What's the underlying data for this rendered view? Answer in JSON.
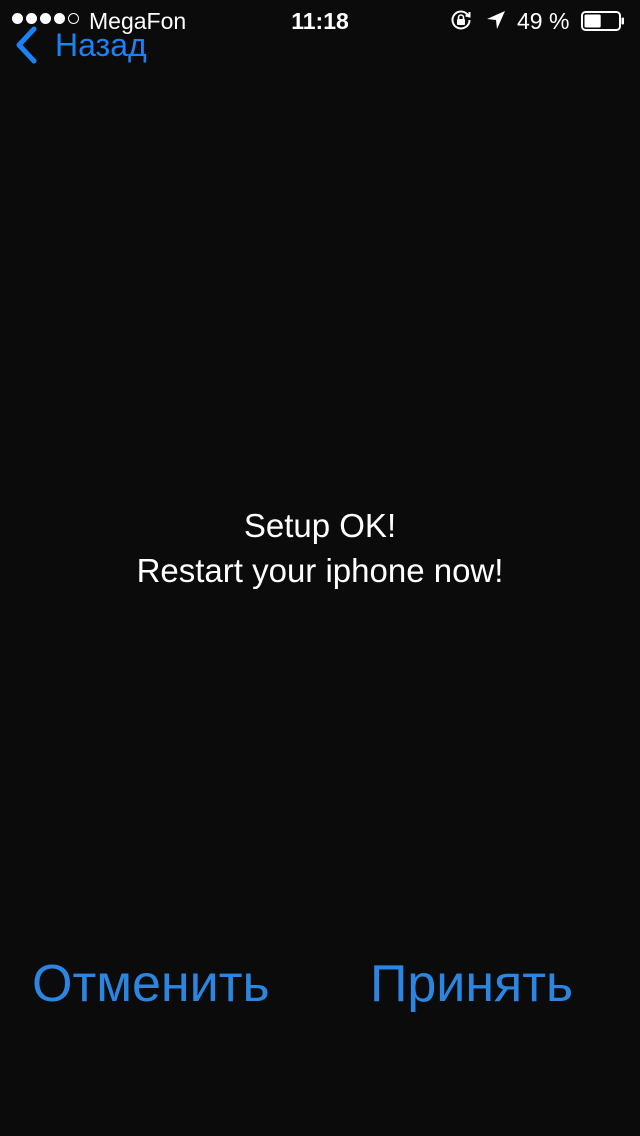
{
  "status_bar": {
    "signal_dots": [
      true,
      true,
      true,
      true,
      false
    ],
    "carrier": "MegaFon",
    "time": "11:18",
    "battery_percent_text": "49 %",
    "battery_level": 0.49,
    "icons": [
      "rotation-lock-icon",
      "location-arrow-icon",
      "battery-icon"
    ]
  },
  "nav": {
    "back_label": "Назад",
    "back_icon": "chevron-left-icon"
  },
  "message": {
    "line1": "Setup OK!",
    "line2": "Restart your iphone now!"
  },
  "actions": {
    "cancel_label": "Отменить",
    "accept_label": "Принять"
  },
  "colors": {
    "background": "#0b0b0b",
    "accent": "#1a82f7",
    "action": "#2a86e0",
    "text": "#ffffff"
  }
}
